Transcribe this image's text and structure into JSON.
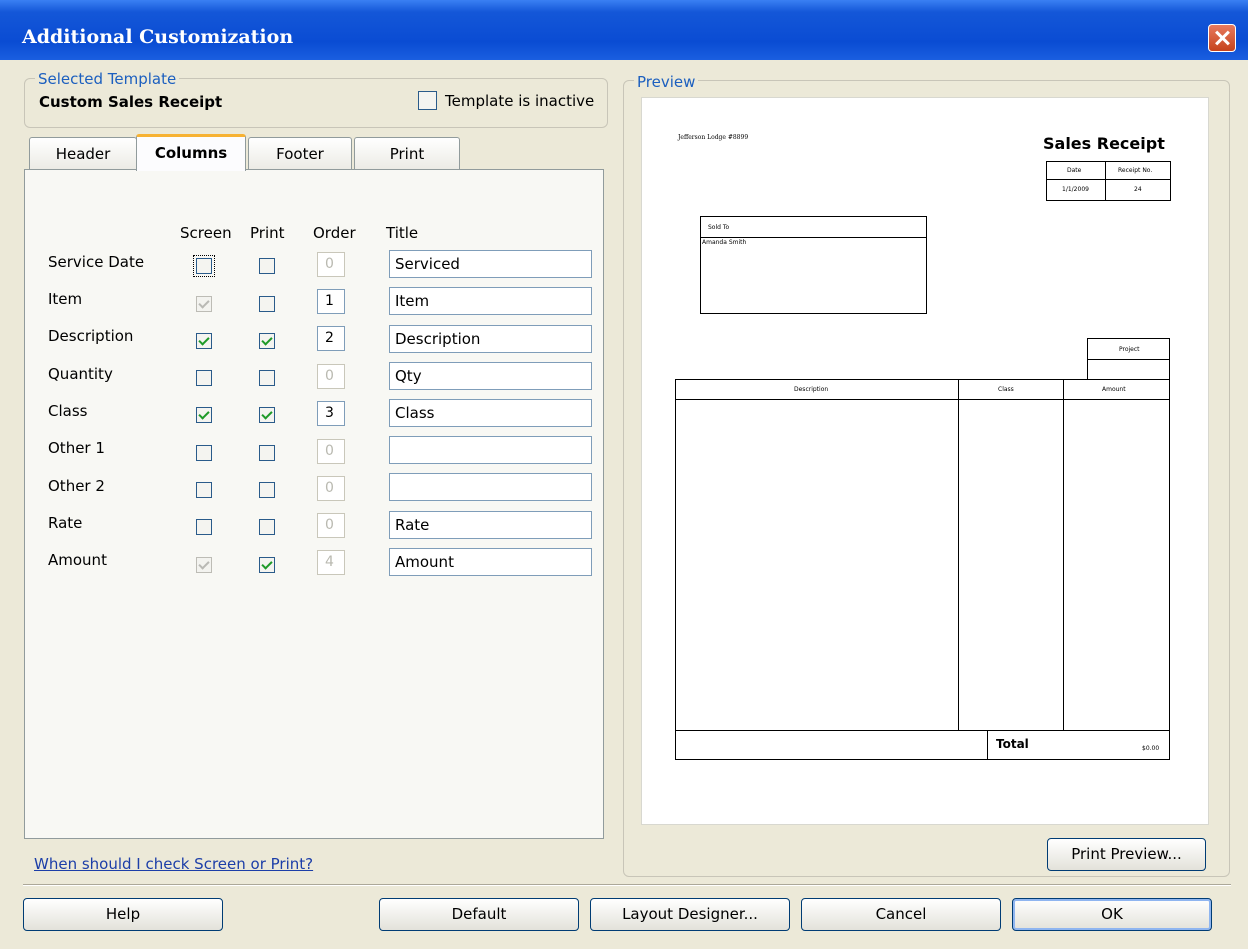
{
  "window": {
    "title": "Additional Customization"
  },
  "selected_template": {
    "group_label": "Selected Template",
    "name": "Custom Sales Receipt",
    "inactive_label": "Template is inactive",
    "inactive_checked": false
  },
  "tabs": [
    {
      "label": "Header",
      "active": false
    },
    {
      "label": "Columns",
      "active": true
    },
    {
      "label": "Footer",
      "active": false
    },
    {
      "label": "Print",
      "active": false
    }
  ],
  "columns_table": {
    "headers": {
      "screen": "Screen",
      "print": "Print",
      "order": "Order",
      "title": "Title"
    },
    "rows": [
      {
        "label": "Service Date",
        "screen": false,
        "screen_disabled": false,
        "print": false,
        "order": "0",
        "order_disabled": true,
        "title": "Serviced"
      },
      {
        "label": "Item",
        "screen": true,
        "screen_disabled": true,
        "print": false,
        "order": "1",
        "order_disabled": false,
        "title": "Item"
      },
      {
        "label": "Description",
        "screen": true,
        "screen_disabled": false,
        "print": true,
        "order": "2",
        "order_disabled": false,
        "title": "Description"
      },
      {
        "label": "Quantity",
        "screen": false,
        "screen_disabled": false,
        "print": false,
        "order": "0",
        "order_disabled": true,
        "title": "Qty"
      },
      {
        "label": "Class",
        "screen": true,
        "screen_disabled": false,
        "print": true,
        "order": "3",
        "order_disabled": false,
        "title": "Class"
      },
      {
        "label": "Other 1",
        "screen": false,
        "screen_disabled": false,
        "print": false,
        "order": "0",
        "order_disabled": true,
        "title": ""
      },
      {
        "label": "Other 2",
        "screen": false,
        "screen_disabled": false,
        "print": false,
        "order": "0",
        "order_disabled": true,
        "title": ""
      },
      {
        "label": "Rate",
        "screen": false,
        "screen_disabled": false,
        "print": false,
        "order": "0",
        "order_disabled": true,
        "title": "Rate"
      },
      {
        "label": "Amount",
        "screen": true,
        "screen_disabled": true,
        "print": true,
        "order": "4",
        "order_disabled": true,
        "title": "Amount"
      }
    ]
  },
  "help_link": "When should I check Screen or Print?",
  "preview": {
    "group_label": "Preview",
    "company": "Jefferson Lodge #8899",
    "doc_title": "Sales Receipt",
    "date_label": "Date",
    "receipt_no_label": "Receipt No.",
    "date_value": "1/1/2009",
    "receipt_no_value": "24",
    "sold_to_label": "Sold To",
    "sold_to_value": "Amanda Smith",
    "project_label": "Project",
    "col_description": "Description",
    "col_class": "Class",
    "col_amount": "Amount",
    "total_label": "Total",
    "total_value": "$0.00",
    "print_preview_button": "Print Preview..."
  },
  "buttons": {
    "help": "Help",
    "default": "Default",
    "layout_designer": "Layout Designer...",
    "cancel": "Cancel",
    "ok": "OK"
  }
}
